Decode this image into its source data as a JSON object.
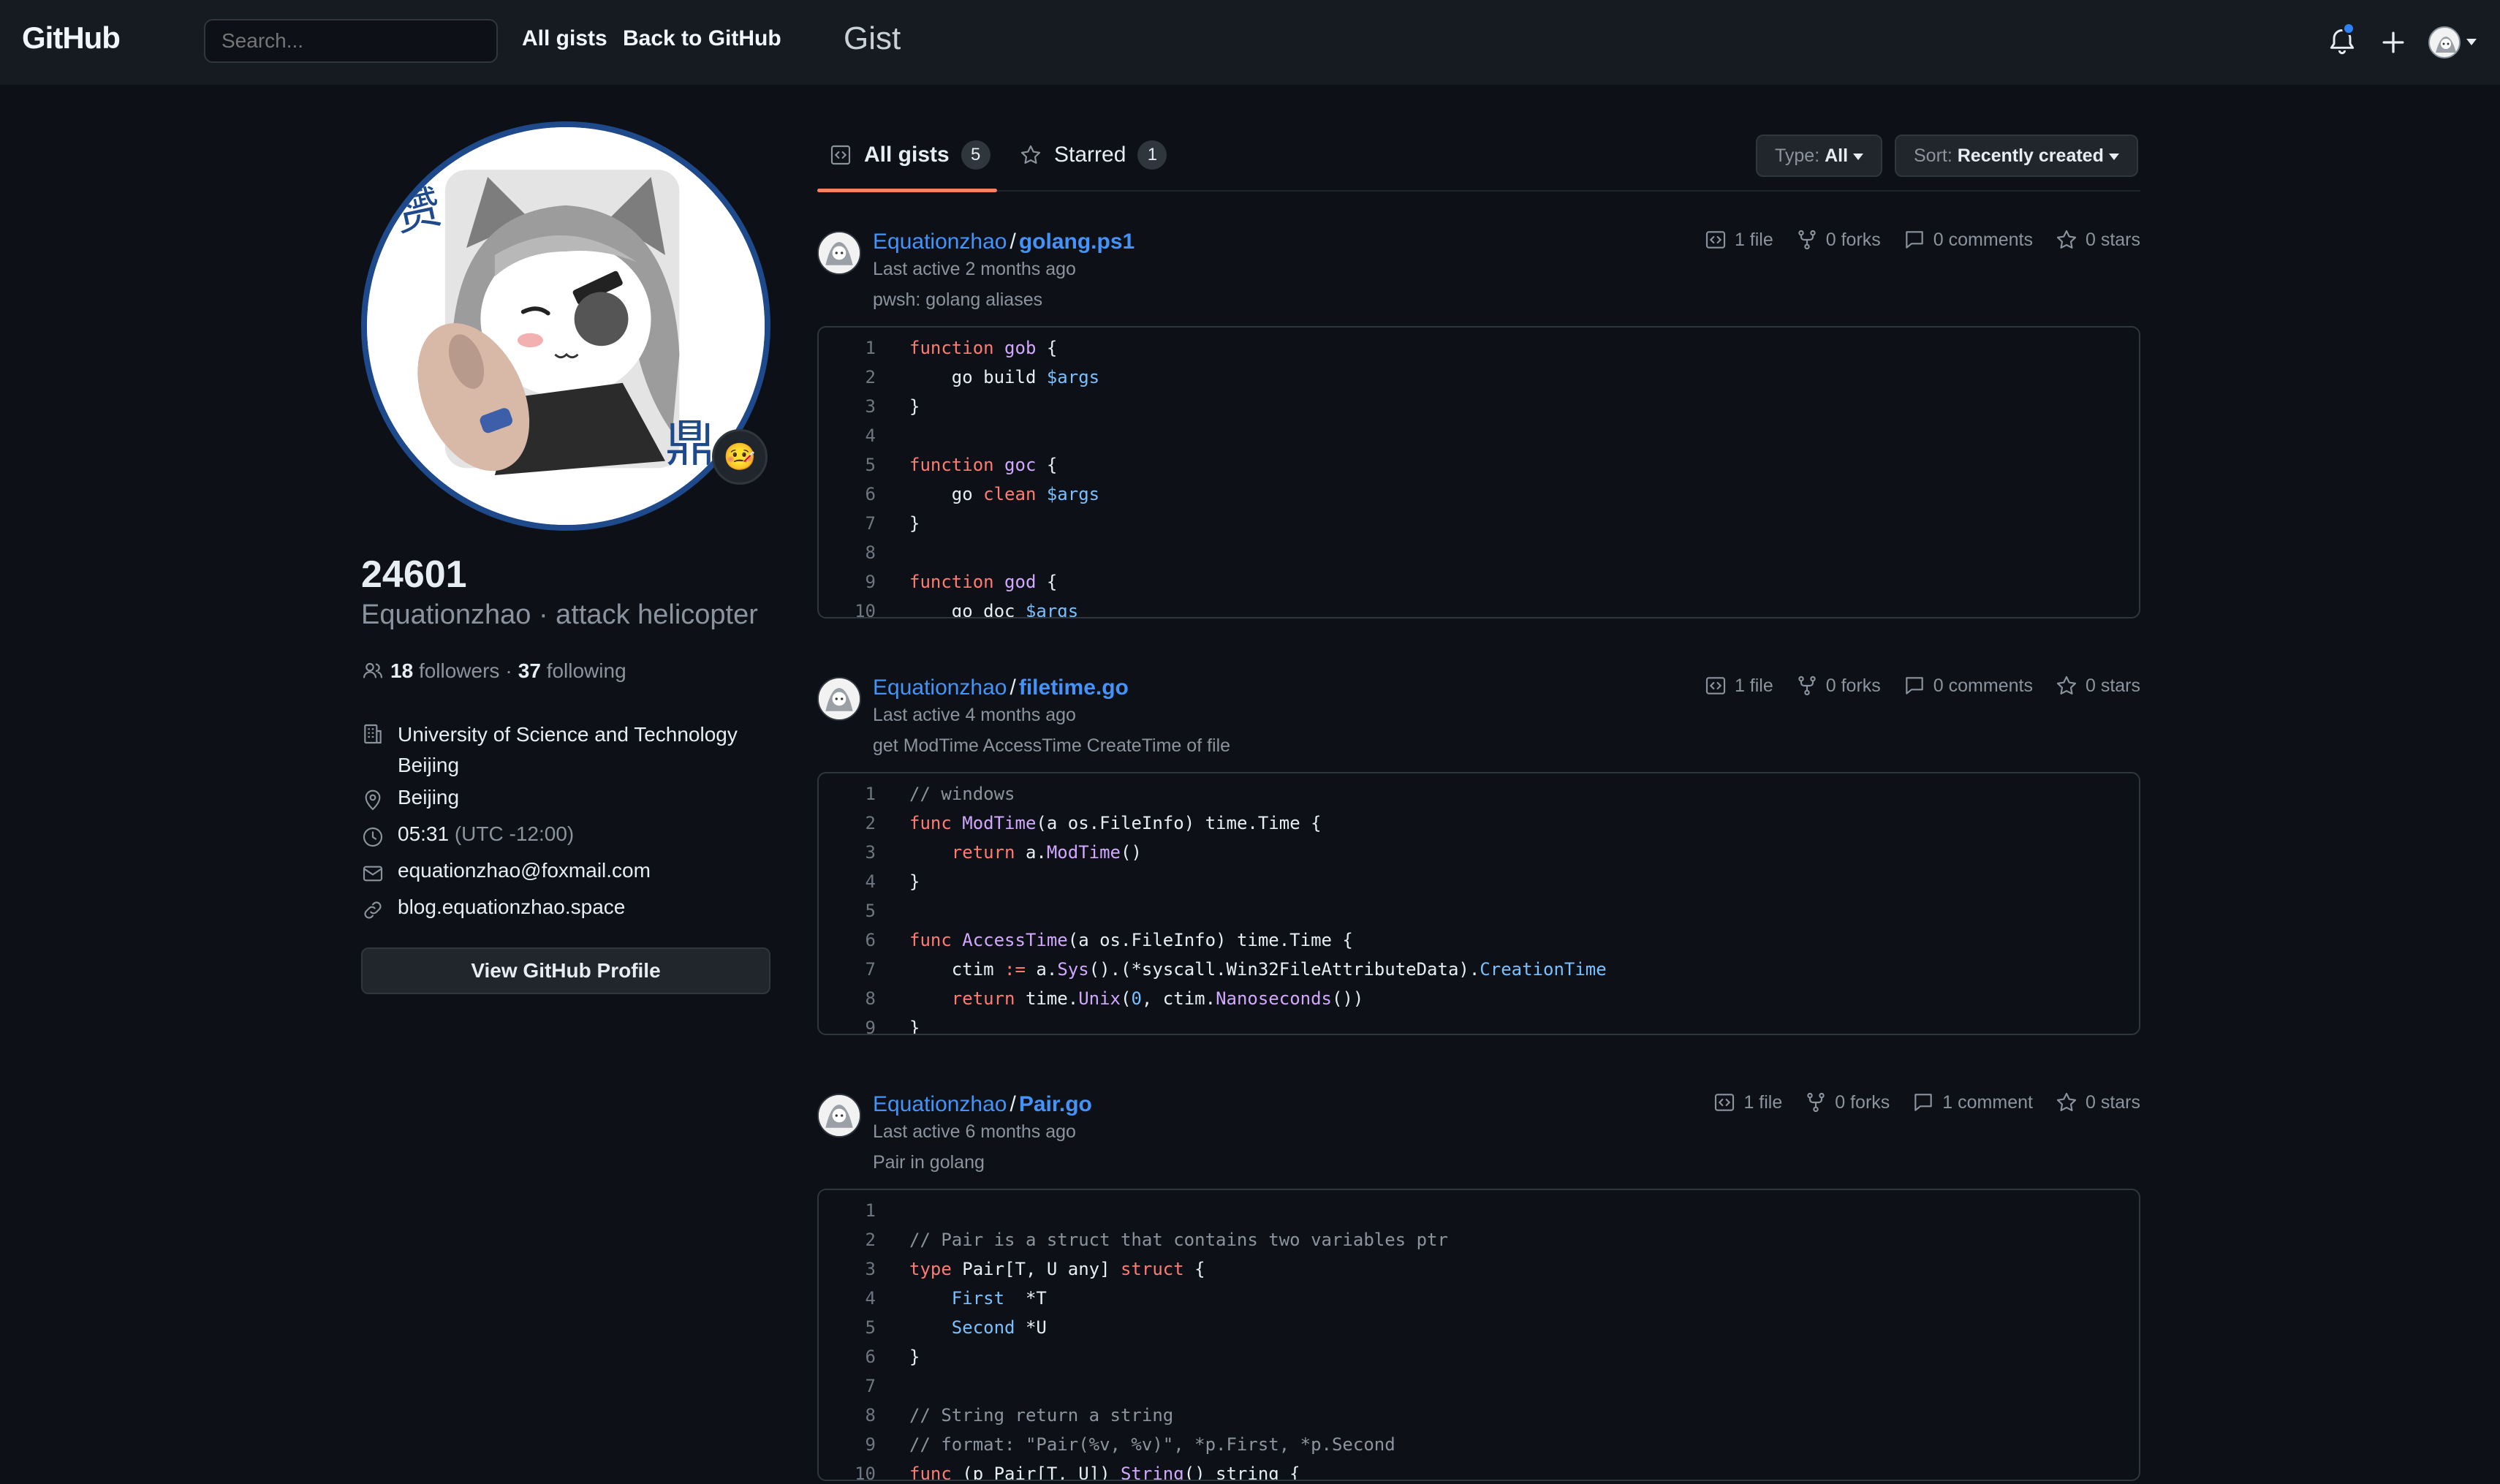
{
  "header": {
    "logo_github": "GitHub",
    "logo_gist": "Gist",
    "search_placeholder": "Search...",
    "nav": [
      "All gists",
      "Back to GitHub"
    ]
  },
  "profile": {
    "username": "24601",
    "handle": "Equationzhao · attack helicopter",
    "status_emoji": "🤒",
    "followers_count": "18",
    "followers_label": "followers",
    "following_count": "37",
    "following_label": "following",
    "organization": "University of Science and Technology Beijing",
    "location": "Beijing",
    "local_time": "05:31",
    "timezone": "(UTC -12:00)",
    "email": "equationzhao@foxmail.com",
    "website": "blog.equationzhao.space",
    "view_profile_label": "View GitHub Profile"
  },
  "tabs": [
    {
      "label": "All gists",
      "count": "5"
    },
    {
      "label": "Starred",
      "count": "1"
    }
  ],
  "filters": {
    "type_label": "Type:",
    "type_value": "All",
    "sort_label": "Sort:",
    "sort_value": "Recently created"
  },
  "gists": [
    {
      "owner": "Equationzhao",
      "name": "golang.ps1",
      "last_active": "Last active 2 months ago",
      "description": "pwsh: golang aliases",
      "files": "1 file",
      "forks": "0 forks",
      "comments": "0 comments",
      "stars": "0 stars",
      "lines": [
        [
          [
            "kw",
            "function"
          ],
          [
            "t",
            " "
          ],
          [
            "fn",
            "gob"
          ],
          [
            "t",
            " {"
          ]
        ],
        [
          [
            "t",
            "    go build "
          ],
          [
            "var",
            "$args"
          ]
        ],
        [
          [
            "t",
            "}"
          ]
        ],
        [],
        [
          [
            "kw",
            "function"
          ],
          [
            "t",
            " "
          ],
          [
            "fn",
            "goc"
          ],
          [
            "t",
            " {"
          ]
        ],
        [
          [
            "t",
            "    go "
          ],
          [
            "kw",
            "clean"
          ],
          [
            "t",
            " "
          ],
          [
            "var",
            "$args"
          ]
        ],
        [
          [
            "t",
            "}"
          ]
        ],
        [],
        [
          [
            "kw",
            "function"
          ],
          [
            "t",
            " "
          ],
          [
            "fn",
            "god"
          ],
          [
            "t",
            " {"
          ]
        ],
        [
          [
            "t",
            "    go doc "
          ],
          [
            "var",
            "$args"
          ]
        ]
      ]
    },
    {
      "owner": "Equationzhao",
      "name": "filetime.go",
      "last_active": "Last active 4 months ago",
      "description": "get ModTime AccessTime CreateTime of file",
      "files": "1 file",
      "forks": "0 forks",
      "comments": "0 comments",
      "stars": "0 stars",
      "lines": [
        [
          [
            "cm",
            "// windows"
          ]
        ],
        [
          [
            "kw",
            "func"
          ],
          [
            "t",
            " "
          ],
          [
            "fn",
            "ModTime"
          ],
          [
            "t",
            "(a os.FileInfo) time.Time {"
          ]
        ],
        [
          [
            "t",
            "    "
          ],
          [
            "kw",
            "return"
          ],
          [
            "t",
            " a."
          ],
          [
            "fn",
            "ModTime"
          ],
          [
            "t",
            "()"
          ]
        ],
        [
          [
            "t",
            "}"
          ]
        ],
        [],
        [
          [
            "kw",
            "func"
          ],
          [
            "t",
            " "
          ],
          [
            "fn",
            "AccessTime"
          ],
          [
            "t",
            "(a os.FileInfo) time.Time {"
          ]
        ],
        [
          [
            "t",
            "    ctim "
          ],
          [
            "kw",
            ":="
          ],
          [
            "t",
            " a."
          ],
          [
            "fn",
            "Sys"
          ],
          [
            "t",
            "().(*syscall.Win32FileAttributeData)."
          ],
          [
            "prop",
            "CreationTime"
          ]
        ],
        [
          [
            "t",
            "    "
          ],
          [
            "kw",
            "return"
          ],
          [
            "t",
            " time."
          ],
          [
            "fn",
            "Unix"
          ],
          [
            "t",
            "("
          ],
          [
            "var",
            "0"
          ],
          [
            "t",
            ", ctim."
          ],
          [
            "fn",
            "Nanoseconds"
          ],
          [
            "t",
            "())"
          ]
        ],
        [
          [
            "t",
            "}"
          ]
        ]
      ]
    },
    {
      "owner": "Equationzhao",
      "name": "Pair.go",
      "last_active": "Last active 6 months ago",
      "description": "Pair in golang",
      "files": "1 file",
      "forks": "0 forks",
      "comments": "1 comment",
      "stars": "0 stars",
      "lines": [
        [],
        [
          [
            "cm",
            "// Pair is a struct that contains two variables ptr"
          ]
        ],
        [
          [
            "kw",
            "type"
          ],
          [
            "t",
            " Pair[T, U any] "
          ],
          [
            "kw",
            "struct"
          ],
          [
            "t",
            " {"
          ]
        ],
        [
          [
            "t",
            "    "
          ],
          [
            "prop",
            "First"
          ],
          [
            "t",
            "  *T"
          ]
        ],
        [
          [
            "t",
            "    "
          ],
          [
            "prop",
            "Second"
          ],
          [
            "t",
            " *U"
          ]
        ],
        [
          [
            "t",
            "}"
          ]
        ],
        [],
        [
          [
            "cm",
            "// String return a string"
          ]
        ],
        [
          [
            "cm",
            "// format: \"Pair(%v, %v)\", *p.First, *p.Second"
          ]
        ],
        [
          [
            "kw",
            "func"
          ],
          [
            "t",
            " (p Pair[T, U]) "
          ],
          [
            "fn",
            "String"
          ],
          [
            "t",
            "() string {"
          ]
        ]
      ]
    }
  ]
}
